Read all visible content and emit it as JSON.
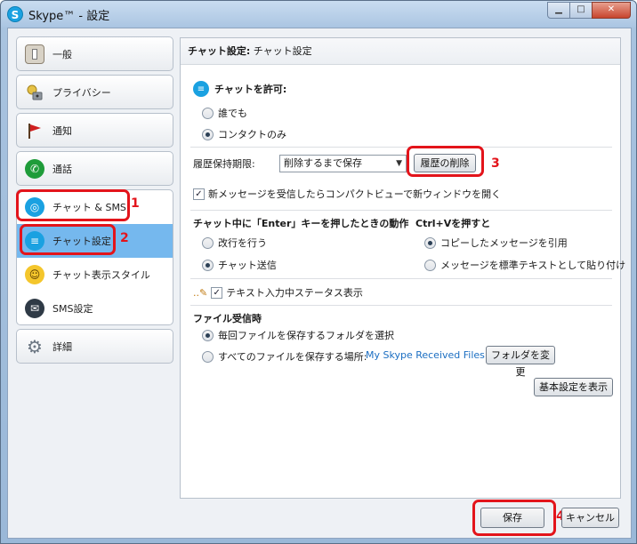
{
  "window": {
    "title": "Skype™ - 設定",
    "icon_letter": "S",
    "min_glyph": "▁",
    "max_glyph": "□",
    "close_glyph": "✕"
  },
  "sidebar": {
    "general": "一般",
    "privacy": "プライバシー",
    "notifications": "通知",
    "calls": "通話",
    "chat_sms": "チャット & SMS",
    "chat_settings": "チャット設定",
    "chat_style": "チャット表示スタイル",
    "sms_settings": "SMS設定",
    "advanced": "詳細"
  },
  "annotations": {
    "n1": "1",
    "n2": "2",
    "n3": "3",
    "n4": "4"
  },
  "panel": {
    "header_bold": "チャット設定:",
    "header_sub": "チャット設定",
    "allow_chat": "チャットを許可:",
    "anyone": "誰でも",
    "contacts_only": "コンタクトのみ",
    "history_label": "履歴保持期限:",
    "history_value": "削除するまで保存",
    "delete_history": "履歴の削除",
    "compact_view": "新メッセージを受信したらコンパクトビューで新ウィンドウを開く",
    "enter_heading": "チャット中に「Enter」キーを押したときの動作",
    "newline": "改行を行う",
    "send_chat": "チャット送信",
    "ctrlv_heading": "Ctrl+Vを押すと",
    "quote_copied": "コピーしたメッセージを引用",
    "paste_plain": "メッセージを標準テキストとして貼り付け",
    "typing_status": "テキスト入力中ステータス表示",
    "file_heading": "ファイル受信時",
    "ask_folder": "毎回ファイルを保存するフォルダを選択",
    "save_all": "すべてのファイルを保存する場所:",
    "received_folder": "My Skype Received Files",
    "change_folder": "フォルダを変更",
    "show_basic": "基本設定を表示"
  },
  "footer": {
    "save": "保存",
    "cancel": "キャンセル"
  },
  "colors": {
    "accent_selected": "#75b8ee",
    "annotation": "#e3141b",
    "link": "#1b6ec2"
  }
}
